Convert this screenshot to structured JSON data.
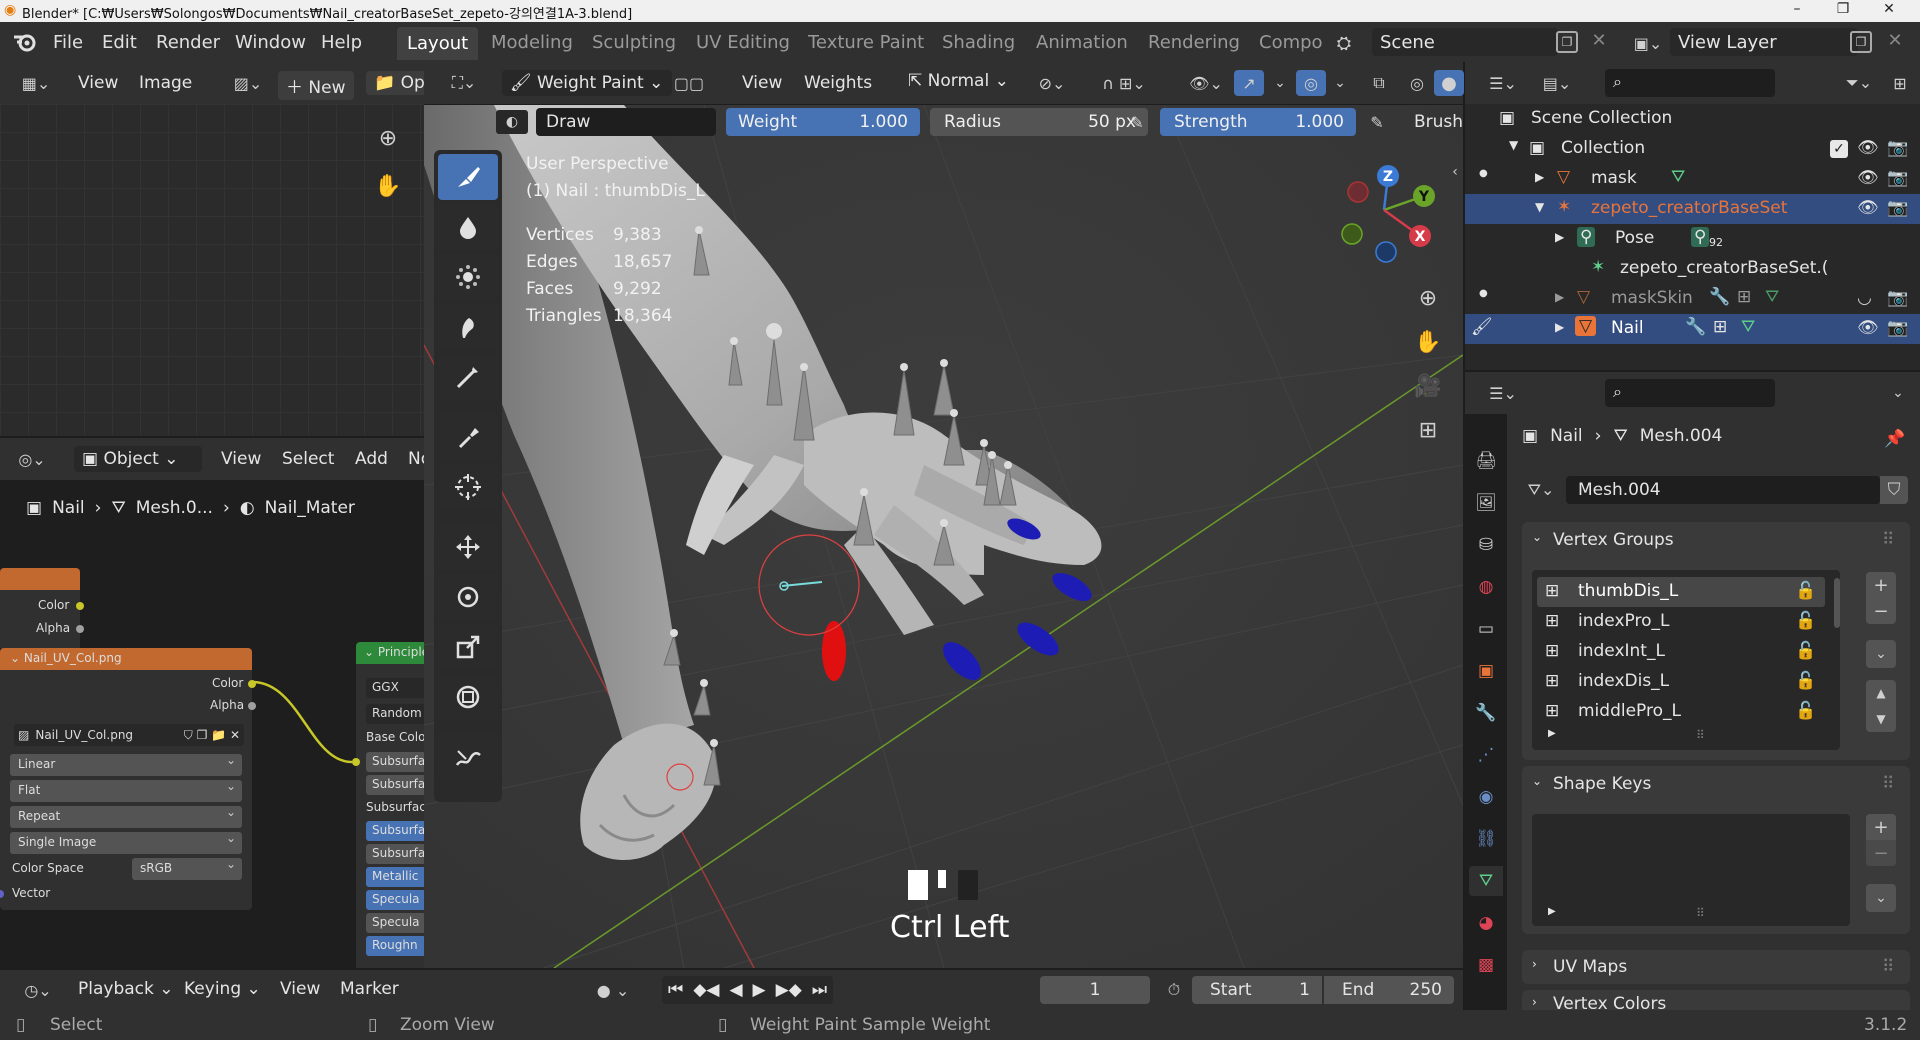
{
  "window": {
    "title": "Blender* [C:₩Users₩Solongos₩Documents₩Nail_creatorBaseSet_zepeto-강의연결1A-3.blend]"
  },
  "menu": {
    "file": "File",
    "edit": "Edit",
    "render": "Render",
    "window": "Window",
    "help": "Help"
  },
  "workspaces": [
    "Layout",
    "Modeling",
    "Sculpting",
    "UV Editing",
    "Texture Paint",
    "Shading",
    "Animation",
    "Rendering",
    "Compo"
  ],
  "scene": {
    "label": "Scene",
    "view_layer": "View Layer"
  },
  "image_editor": {
    "view": "View",
    "image": "Image",
    "new": "New",
    "open": "Op"
  },
  "viewport_header": {
    "mode": "Weight Paint",
    "view": "View",
    "weights": "Weights",
    "orientation": "Normal"
  },
  "tool_settings": {
    "brush": "Draw",
    "weight_label": "Weight",
    "weight_value": "1.000",
    "radius_label": "Radius",
    "radius_value": "50 px",
    "strength_label": "Strength",
    "strength_value": "1.000",
    "brush_menu": "Brush"
  },
  "overlay": {
    "perspective": "User Perspective",
    "object": "(1) Nail : thumbDis_L"
  },
  "stats": [
    {
      "label": "Vertices",
      "value": "9,383"
    },
    {
      "label": "Edges",
      "value": "18,657"
    },
    {
      "label": "Faces",
      "value": "9,292"
    },
    {
      "label": "Triangles",
      "value": "18,364"
    }
  ],
  "gizmo": {
    "z": "Z",
    "y": "Y",
    "x": "X"
  },
  "keystroke": "Ctrl Left",
  "node_editor": {
    "mode": "Object",
    "view": "View",
    "select": "Select",
    "add": "Add",
    "node": "No",
    "breadcrumb": [
      "Nail",
      "Mesh.0...",
      "Nail_Mater"
    ]
  },
  "nodes": {
    "top": {
      "color": "Color",
      "alpha": "Alpha"
    },
    "image": {
      "title": "Nail_UV_Col.png",
      "color": "Color",
      "alpha": "Alpha",
      "file": "Nail_UV_Col.png",
      "interp": "Linear",
      "proj": "Flat",
      "ext": "Repeat",
      "source": "Single Image",
      "cs_label": "Color Space",
      "cs_value": "sRGB",
      "vector": "Vector"
    },
    "principled": {
      "title": "Principle",
      "dist": "GGX",
      "sss": "Random",
      "base": "Base Colo",
      "inputs": [
        "Subsurfa",
        "Subsurfa",
        "Subsurfac",
        "Subsurfa",
        "Subsurfa",
        "Metallic",
        "Specula",
        "Specula",
        "Roughn"
      ]
    }
  },
  "outliner": {
    "scene_collection": "Scene Collection",
    "collection": "Collection",
    "items": [
      "mask",
      "zepeto_creatorBaseSet",
      "Pose",
      "zepeto_creatorBaseSet.(",
      "maskSkin",
      "Nail"
    ],
    "pose_count": "92"
  },
  "properties": {
    "object": "Nail",
    "mesh": "Mesh.004",
    "mesh_field": "Mesh.004",
    "vertex_groups_title": "Vertex Groups",
    "vertex_groups": [
      "thumbDis_L",
      "indexPro_L",
      "indexInt_L",
      "indexDis_L",
      "middlePro_L"
    ],
    "shape_keys_title": "Shape Keys",
    "uv_maps_title": "UV Maps",
    "vertex_colors_title": "Vertex Colors"
  },
  "timeline": {
    "playback": "Playback",
    "keying": "Keying",
    "view": "View",
    "marker": "Marker",
    "current": "1",
    "start_label": "Start",
    "start": "1",
    "end_label": "End",
    "end": "250"
  },
  "status": {
    "select": "Select",
    "zoom": "Zoom View",
    "sample": "Weight Paint Sample Weight",
    "version": "3.1.2"
  },
  "colors": {
    "accent": "#4772b3",
    "selected_row": "#334d80",
    "active_orange": "#e8743a",
    "vgroup_sel": "#3d3d3d"
  }
}
